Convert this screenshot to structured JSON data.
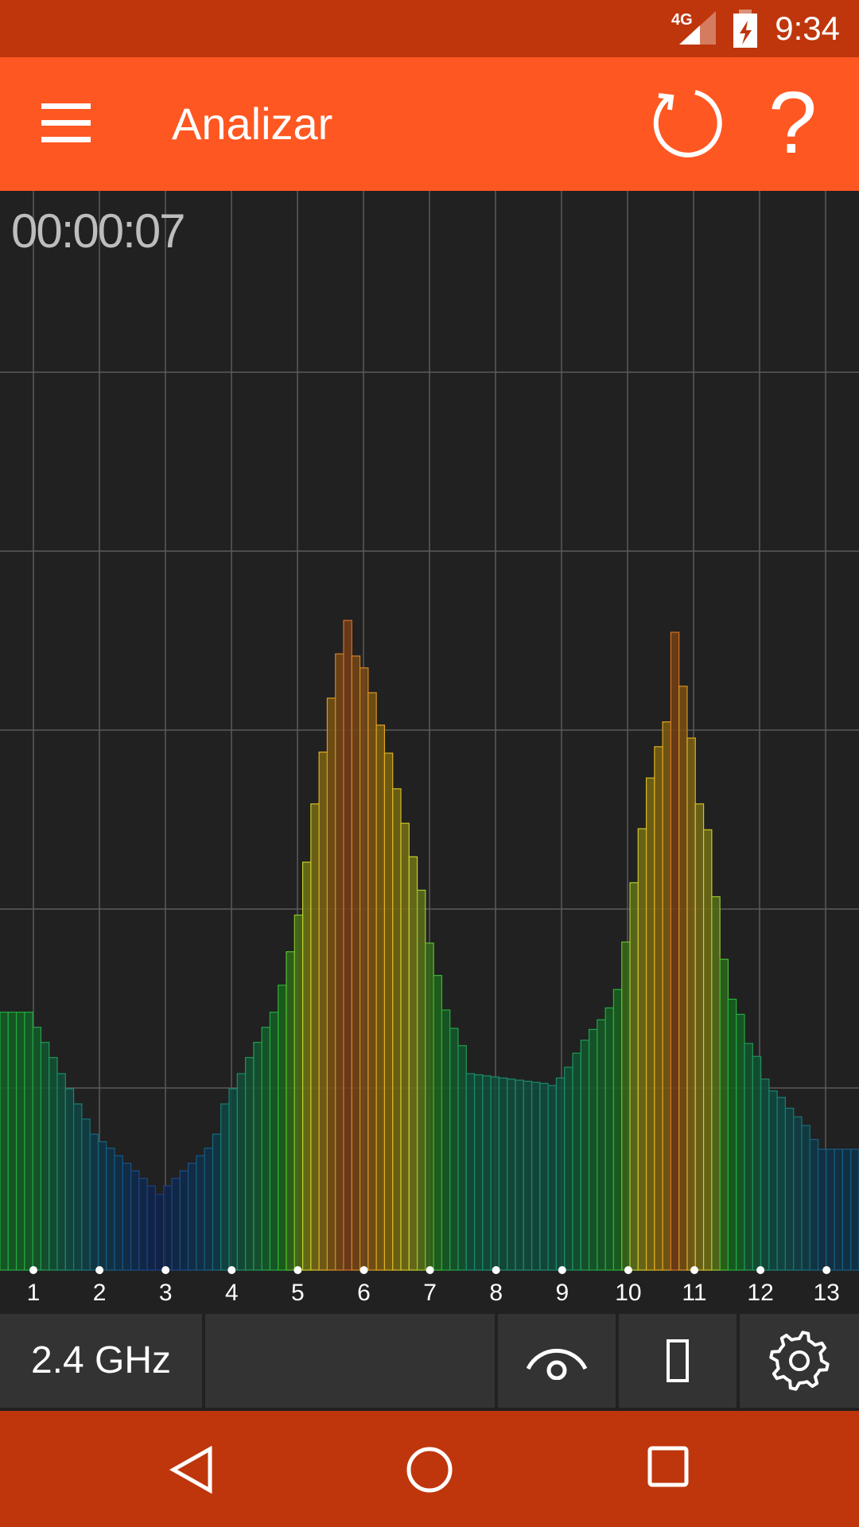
{
  "status": {
    "time": "9:34",
    "network": "4G"
  },
  "appbar": {
    "title": "Analizar"
  },
  "timer": "00:00:07",
  "band": "2.4 GHz",
  "channels": [
    "1",
    "2",
    "3",
    "4",
    "5",
    "6",
    "7",
    "8",
    "9",
    "10",
    "11",
    "12",
    "13"
  ],
  "spectrum_levels": [
    0.239,
    0.239,
    0.239,
    0.239,
    0.225,
    0.211,
    0.197,
    0.182,
    0.168,
    0.154,
    0.14,
    0.126,
    0.119,
    0.113,
    0.106,
    0.099,
    0.092,
    0.085,
    0.078,
    0.07,
    0.078,
    0.085,
    0.092,
    0.099,
    0.106,
    0.113,
    0.126,
    0.154,
    0.168,
    0.182,
    0.197,
    0.211,
    0.225,
    0.239,
    0.264,
    0.295,
    0.329,
    0.378,
    0.432,
    0.48,
    0.53,
    0.571,
    0.602,
    0.569,
    0.558,
    0.535,
    0.505,
    0.479,
    0.446,
    0.414,
    0.383,
    0.352,
    0.303,
    0.273,
    0.241,
    0.224,
    0.208,
    0.182,
    0.181,
    0.18,
    0.179,
    0.178,
    0.177,
    0.176,
    0.175,
    0.174,
    0.173,
    0.171,
    0.178,
    0.188,
    0.201,
    0.213,
    0.223,
    0.232,
    0.243,
    0.26,
    0.304,
    0.359,
    0.409,
    0.456,
    0.485,
    0.508,
    0.591,
    0.541,
    0.493,
    0.432,
    0.408,
    0.346,
    0.288,
    0.251,
    0.237,
    0.21,
    0.198,
    0.177,
    0.166,
    0.16,
    0.15,
    0.142,
    0.134,
    0.121,
    0.112,
    0.112,
    0.112,
    0.112,
    0.112
  ]
}
